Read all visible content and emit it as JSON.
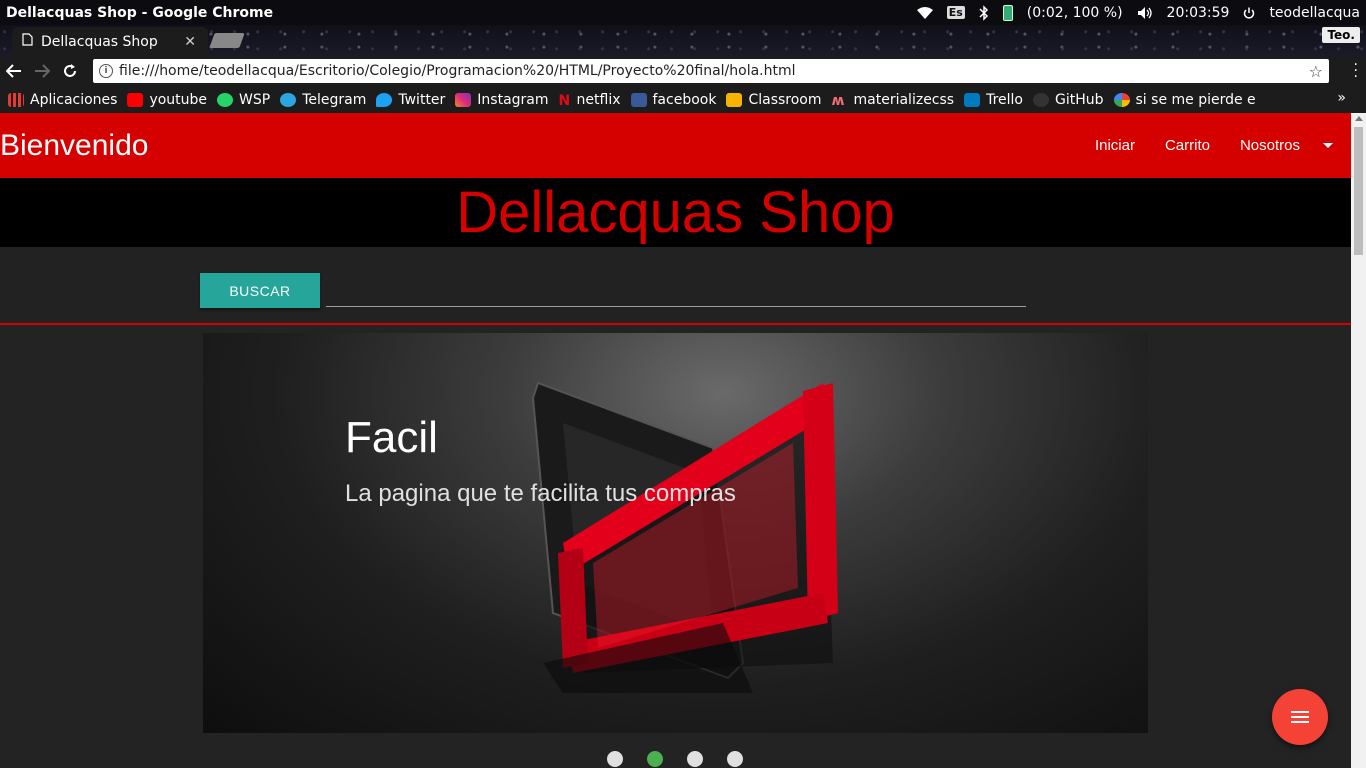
{
  "os": {
    "window_title": "Dellacquas Shop - Google Chrome",
    "keyboard": "Es",
    "battery": "(0:02, 100 %)",
    "time": "20:03:59",
    "user": "teodellacqua"
  },
  "chrome": {
    "tab_title": "Dellacquas Shop",
    "profile": "Teo.",
    "url": "file:///home/teodellacqua/Escritorio/Colegio/Programacion%20/HTML/Proyecto%20final/hola.html"
  },
  "bookmarks": [
    {
      "label": "Aplicaciones",
      "icon": "apps-grid-icon",
      "color": "#e53935"
    },
    {
      "label": "youtube",
      "icon": "youtube-icon",
      "color": "#ff0000"
    },
    {
      "label": "WSP",
      "icon": "whatsapp-icon",
      "color": "#25d366"
    },
    {
      "label": "Telegram",
      "icon": "telegram-icon",
      "color": "#2ca5e0"
    },
    {
      "label": "Twitter",
      "icon": "twitter-icon",
      "color": "#1da1f2"
    },
    {
      "label": "Instagram",
      "icon": "instagram-icon",
      "color": "#c13584"
    },
    {
      "label": "netflix",
      "icon": "netflix-icon",
      "color": "#e50914"
    },
    {
      "label": "facebook",
      "icon": "facebook-icon",
      "color": "#3b5998"
    },
    {
      "label": "Classroom",
      "icon": "classroom-icon",
      "color": "#f4b400"
    },
    {
      "label": "materializecss",
      "icon": "materialize-icon",
      "color": "#ee6e73"
    },
    {
      "label": "Trello",
      "icon": "trello-icon",
      "color": "#0079bf"
    },
    {
      "label": "GitHub",
      "icon": "github-icon",
      "color": "#333333"
    },
    {
      "label": "si se me pierde e",
      "icon": "google-icon",
      "color": "#4285f4"
    }
  ],
  "page": {
    "brand": "Bienvenido",
    "nav": {
      "iniciar": "Iniciar",
      "carrito": "Carrito",
      "nosotros": "Nosotros"
    },
    "hero_title": "Dellacquas Shop",
    "search_button": "BUSCAR",
    "search_value": "",
    "slide": {
      "title": "Facil",
      "subtitle": "La pagina que te facilita tus compras"
    },
    "carousel": {
      "slides": 4,
      "active_index": 1
    },
    "colors": {
      "navbar": "#d50000",
      "button": "#26a69a",
      "fab": "#f44336",
      "active_dot": "#4caf50"
    }
  }
}
